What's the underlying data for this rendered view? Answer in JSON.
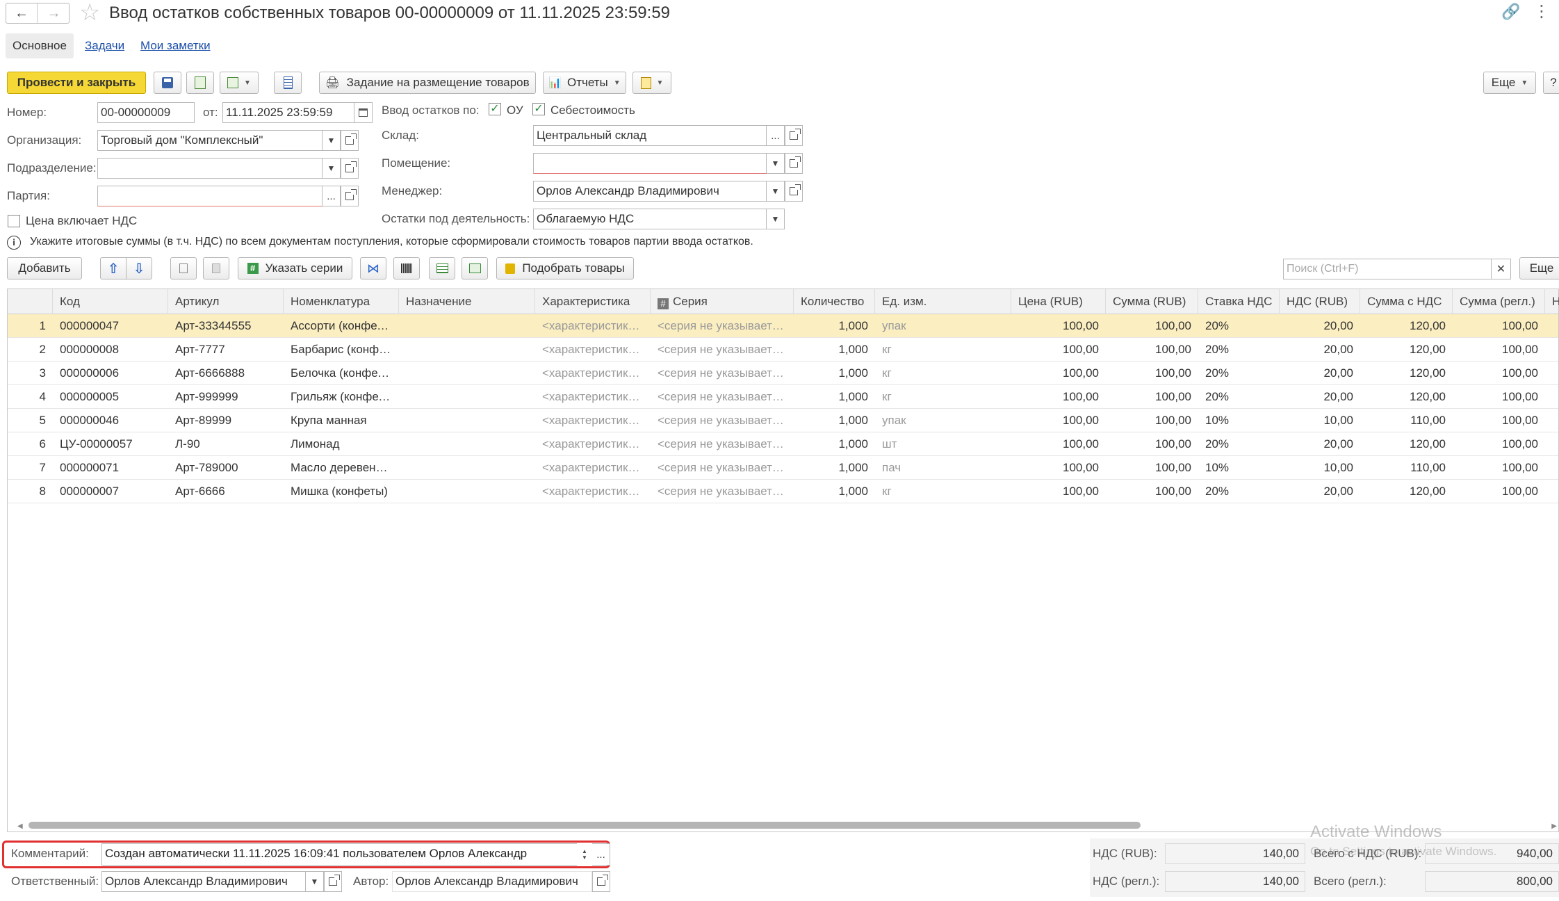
{
  "window": {
    "title": "Ввод остатков собственных товаров 00-00000009 от 11.11.2025 23:59:59"
  },
  "tabs": [
    {
      "label": "Основное"
    },
    {
      "label": "Задачи"
    },
    {
      "label": "Мои заметки"
    }
  ],
  "toolbar": {
    "post_close": "Провести и закрыть",
    "placement_task": "Задание на размещение товаров",
    "reports": "Отчеты",
    "more": "Еще",
    "help": "?"
  },
  "form": {
    "number_label": "Номер:",
    "number_value": "00-00000009",
    "date_label": "от:",
    "date_value": "11.11.2025 23:59:59",
    "org_label": "Организация:",
    "org_value": "Торговый дом \"Комплексный\"",
    "division_label": "Подразделение:",
    "division_value": "",
    "batch_label": "Партия:",
    "batch_value": "",
    "price_vat_label": "Цена включает НДС",
    "input_by_label": "Ввод остатков по:",
    "ou_label": "ОУ",
    "cost_label": "Себестоимость",
    "warehouse_label": "Склад:",
    "warehouse_value": "Центральный склад",
    "room_label": "Помещение:",
    "room_value": "",
    "manager_label": "Менеджер:",
    "manager_value": "Орлов Александр Владимирович",
    "activity_label": "Остатки под деятельность:",
    "activity_value": "Облагаемую НДС",
    "info_text": "Укажите итоговые суммы (в т.ч. НДС) по всем документам поступления, которые сформировали стоимость товаров партии ввода остатков."
  },
  "table_toolbar": {
    "add": "Добавить",
    "specify_series": "Указать серии",
    "pick_goods": "Подобрать товары",
    "search_placeholder": "Поиск (Ctrl+F)",
    "more": "Еще"
  },
  "table": {
    "columns": [
      "Код",
      "Артикул",
      "Номенклатура",
      "Назначение",
      "Характеристика",
      "Серия",
      "Количество",
      "Ед. изм.",
      "Цена (RUB)",
      "Сумма (RUB)",
      "Ставка НДС",
      "НДС (RUB)",
      "Сумма с НДС",
      "Сумма (регл.)",
      "Н"
    ],
    "rows": [
      {
        "n": "1",
        "code": "000000047",
        "art": "Арт-33344555",
        "nom": "Ассорти (конфеты)",
        "purpose": "",
        "char": "<характеристики не используются>",
        "series": "<серия не указывается>",
        "qty": "1,000",
        "unit": "упак",
        "price": "100,00",
        "sum": "100,00",
        "rate": "20%",
        "vat": "20,00",
        "sum_vat": "120,00",
        "sum_reg": "100,00"
      },
      {
        "n": "2",
        "code": "000000008",
        "art": "Арт-7777",
        "nom": "Барбарис (конфеты)",
        "purpose": "",
        "char": "<характеристики не используются>",
        "series": "<серия не указывается>",
        "qty": "1,000",
        "unit": "кг",
        "price": "100,00",
        "sum": "100,00",
        "rate": "20%",
        "vat": "20,00",
        "sum_vat": "120,00",
        "sum_reg": "100,00"
      },
      {
        "n": "3",
        "code": "000000006",
        "art": "Арт-6666888",
        "nom": "Белочка (конфеты)",
        "purpose": "",
        "char": "<характеристики не используются>",
        "series": "<серия не указывается>",
        "qty": "1,000",
        "unit": "кг",
        "price": "100,00",
        "sum": "100,00",
        "rate": "20%",
        "vat": "20,00",
        "sum_vat": "120,00",
        "sum_reg": "100,00"
      },
      {
        "n": "4",
        "code": "000000005",
        "art": "Арт-999999",
        "nom": "Грильяж (конфеты)",
        "purpose": "",
        "char": "<характеристики не используются>",
        "series": "<серия не указывается>",
        "qty": "1,000",
        "unit": "кг",
        "price": "100,00",
        "sum": "100,00",
        "rate": "20%",
        "vat": "20,00",
        "sum_vat": "120,00",
        "sum_reg": "100,00"
      },
      {
        "n": "5",
        "code": "000000046",
        "art": "Арт-89999",
        "nom": "Крупа манная",
        "purpose": "",
        "char": "<характеристики не используются>",
        "series": "<серия не указывается>",
        "qty": "1,000",
        "unit": "упак",
        "price": "100,00",
        "sum": "100,00",
        "rate": "10%",
        "vat": "10,00",
        "sum_vat": "110,00",
        "sum_reg": "100,00"
      },
      {
        "n": "6",
        "code": "ЦУ-00000057",
        "art": "Л-90",
        "nom": "Лимонад",
        "purpose": "",
        "char": "<характеристики не используются>",
        "series": "<серия не указывается>",
        "qty": "1,000",
        "unit": "шт",
        "price": "100,00",
        "sum": "100,00",
        "rate": "20%",
        "vat": "20,00",
        "sum_vat": "120,00",
        "sum_reg": "100,00"
      },
      {
        "n": "7",
        "code": "000000071",
        "art": "Арт-789000",
        "nom": "Масло деревенское",
        "purpose": "",
        "char": "<характеристики не используются>",
        "series": "<серия не указывается>",
        "qty": "1,000",
        "unit": "пач",
        "price": "100,00",
        "sum": "100,00",
        "rate": "10%",
        "vat": "10,00",
        "sum_vat": "110,00",
        "sum_reg": "100,00"
      },
      {
        "n": "8",
        "code": "000000007",
        "art": "Арт-6666",
        "nom": "Мишка (конфеты)",
        "purpose": "",
        "char": "<характеристики не используются>",
        "series": "<серия не указывается>",
        "qty": "1,000",
        "unit": "кг",
        "price": "100,00",
        "sum": "100,00",
        "rate": "20%",
        "vat": "20,00",
        "sum_vat": "120,00",
        "sum_reg": "100,00"
      }
    ]
  },
  "footer": {
    "comment_label": "Комментарий:",
    "comment_value": "Создан автоматически 11.11.2025 16:09:41 пользователем Орлов Александр",
    "responsible_label": "Ответственный:",
    "responsible_value": "Орлов Александр Владимирович",
    "author_label": "Автор:",
    "author_value": "Орлов Александр Владимирович",
    "vat_rub_label": "НДС (RUB):",
    "vat_rub_value": "140,00",
    "total_vat_rub_label": "Всего с НДС (RUB):",
    "total_vat_rub_value": "940,00",
    "vat_reg_label": "НДС (регл.):",
    "vat_reg_value": "140,00",
    "total_reg_label": "Всего (регл.):",
    "total_reg_value": "800,00"
  },
  "watermark": {
    "line1": "Activate Windows",
    "line2": "Go to Settings to activate Windows."
  },
  "colors": {
    "accent_yellow": "#f5d835",
    "selected_row": "#fbeec1",
    "highlight_red": "#e03030",
    "link_blue": "#1a4ea8"
  }
}
